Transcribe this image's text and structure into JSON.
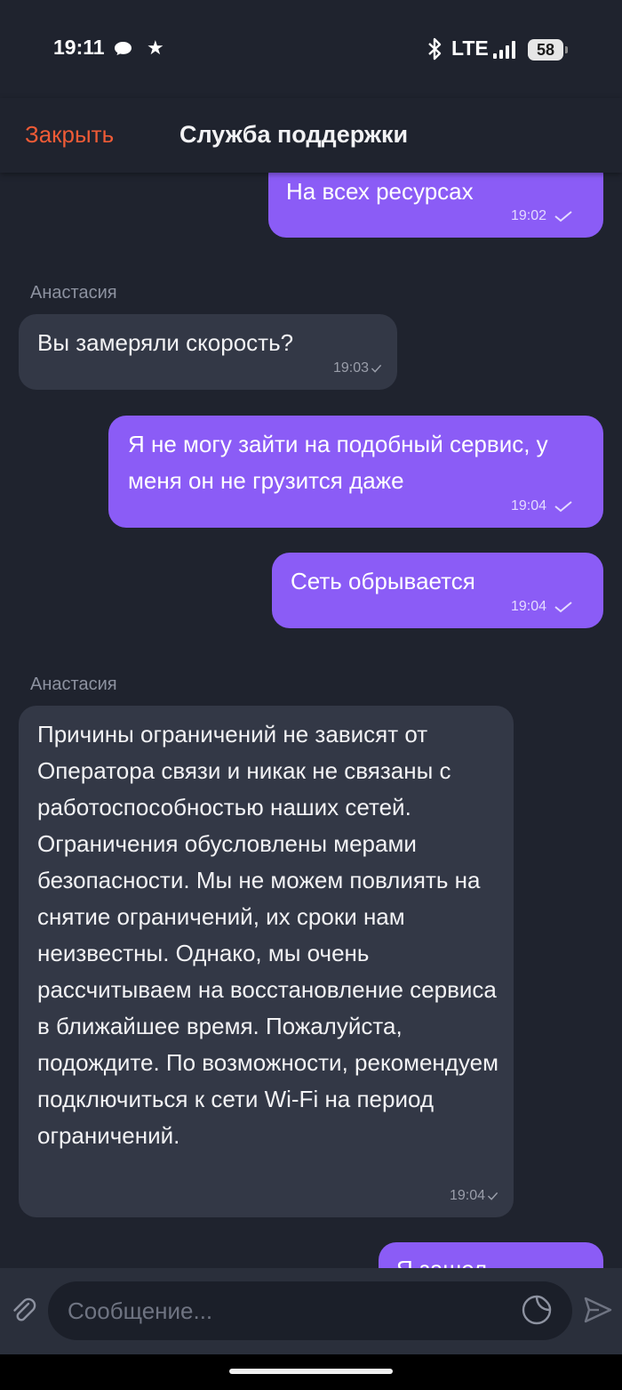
{
  "status_bar": {
    "time": "19:11",
    "network": "LTE",
    "battery": "58",
    "icons": [
      "chat-bubble-icon",
      "star-icon",
      "bluetooth-icon",
      "signal-icon",
      "battery-icon"
    ]
  },
  "header": {
    "close_label": "Закрыть",
    "title": "Служба поддержки"
  },
  "messages": [
    {
      "direction": "out",
      "text": "На всех ресурсах",
      "time": "19:02"
    },
    {
      "direction": "in",
      "sender": "Анастасия",
      "text": "Вы замеряли скорость?",
      "time": "19:03"
    },
    {
      "direction": "out",
      "text": "Я не могу зайти на подобный сервис, у меня он не грузится даже",
      "time": "19:04"
    },
    {
      "direction": "out",
      "text": "Сеть обрывается",
      "time": "19:04"
    },
    {
      "direction": "in",
      "sender": "Анастасия",
      "text": "Причины ограничений не зависят от Оператора связи и никак не связаны с работоспособностью наших сетей. Ограничения обусловлены мерами безопасности. Мы не можем повлиять на снятие ограничений, их сроки нам неизвестны. Однако, мы очень рассчитываем на восстановление сервиса в ближайшее время. Пожалуйста, подождите. По возможности, рекомендуем подключиться к сети Wi-Fi на период ограничений.",
      "time": "19:04"
    },
    {
      "direction": "out",
      "text": "Я зашел",
      "time": ""
    }
  ],
  "composer": {
    "placeholder": "Сообщение..."
  },
  "colors": {
    "background": "#1f232e",
    "outgoing_bubble": "#8b5cf6",
    "incoming_bubble": "#333846",
    "accent_close": "#ef5b36"
  }
}
